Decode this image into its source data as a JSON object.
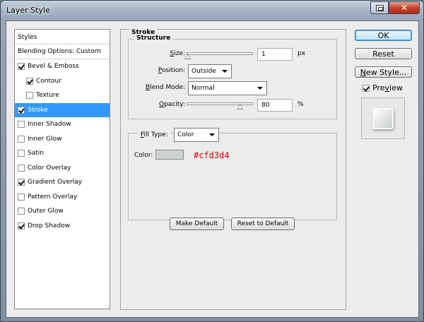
{
  "window": {
    "title": "Layer Style",
    "close_glyph": "✕",
    "help_icon": "help-icon",
    "close_icon": "close-icon"
  },
  "styles": [
    {
      "label": "Styles",
      "checkbox": false,
      "indent": 0
    },
    {
      "label": "Blending Options: Custom",
      "checkbox": false,
      "indent": 0
    },
    {
      "label": "Bevel & Emboss",
      "checkbox": true,
      "checked": true,
      "indent": 0
    },
    {
      "label": "Contour",
      "checkbox": true,
      "checked": true,
      "indent": 1
    },
    {
      "label": "Texture",
      "checkbox": true,
      "checked": false,
      "indent": 1
    },
    {
      "label": "Stroke",
      "checkbox": true,
      "checked": true,
      "indent": 0,
      "selected": true
    },
    {
      "label": "Inner Shadow",
      "checkbox": true,
      "checked": false,
      "indent": 0
    },
    {
      "label": "Inner Glow",
      "checkbox": true,
      "checked": false,
      "indent": 0
    },
    {
      "label": "Satin",
      "checkbox": true,
      "checked": false,
      "indent": 0
    },
    {
      "label": "Color Overlay",
      "checkbox": true,
      "checked": false,
      "indent": 0
    },
    {
      "label": "Gradient Overlay",
      "checkbox": true,
      "checked": true,
      "indent": 0
    },
    {
      "label": "Pattern Overlay",
      "checkbox": true,
      "checked": false,
      "indent": 0
    },
    {
      "label": "Outer Glow",
      "checkbox": true,
      "checked": false,
      "indent": 0
    },
    {
      "label": "Drop Shadow",
      "checkbox": true,
      "checked": true,
      "indent": 0
    }
  ],
  "stroke": {
    "title": "Stroke",
    "structure_title": "Structure",
    "size_label_ul": "S",
    "size_label_rest": "ize:",
    "size_value": "1",
    "size_unit": "px",
    "size_slider_fraction": 0.01,
    "position_label_ul": "P",
    "position_label_rest": "osition:",
    "position_value": "Outside",
    "blend_label_ul": "B",
    "blend_label_rest": "lend Mode:",
    "blend_value": "Normal",
    "opacity_label_ul": "O",
    "opacity_label_rest": "pacity:",
    "opacity_value": "80",
    "opacity_unit": "%",
    "opacity_slider_fraction": 0.8,
    "fill_label_ul": "F",
    "fill_label_rest": "ill Type:",
    "fill_value": "Color",
    "color_label": "Color:",
    "color_hex": "#cfd3d4",
    "color_hex_text_color": "#d40000"
  },
  "buttons": {
    "make_default": "Make Default",
    "reset_default": "Reset to Default",
    "ok": "OK",
    "reset": "Reset",
    "new_style_ul": "N",
    "new_style_rest": "ew Style...",
    "preview_ul": "v",
    "preview_pre": "Pre",
    "preview_post": "iew",
    "preview_checked": true
  },
  "colors": {
    "selection": "#3399ff",
    "stroke_color": "#cfd3d4"
  }
}
